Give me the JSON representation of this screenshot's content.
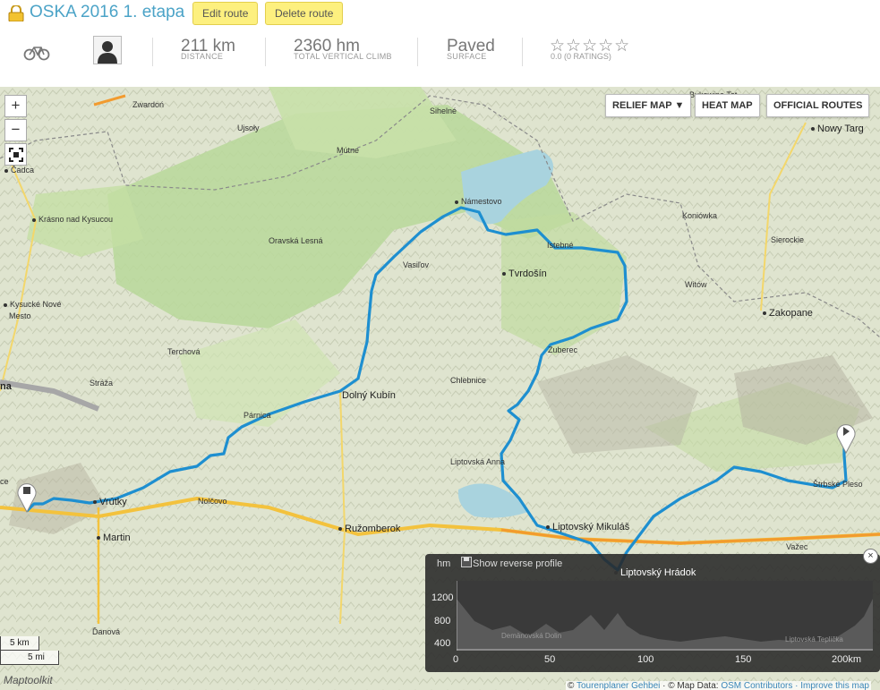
{
  "header": {
    "title": "OSKA 2016 1. etapa",
    "edit_label": "Edit route",
    "delete_label": "Delete route",
    "stats": [
      {
        "value": "211 km",
        "label": "DISTANCE"
      },
      {
        "value": "2360 hm",
        "label": "TOTAL VERTICAL CLIMB"
      },
      {
        "value": "Paved",
        "label": "SURFACE"
      }
    ],
    "stars": "☆☆☆☆☆",
    "ratings": "0.0 (0 RATINGS)",
    "icons": {
      "lock": "lock-icon",
      "bike": "bicycle-icon",
      "avatar": "user-avatar-icon"
    }
  },
  "map": {
    "zoom_in": "+",
    "zoom_out": "−",
    "buttons": {
      "relief": "RELIEF MAP ▼",
      "heat": "HEAT MAP",
      "official": "OFFICIAL ROUTES"
    },
    "places": {
      "zwardon": "Zwardoń",
      "ujsoly": "Ujsoły",
      "mutne": "Mútne",
      "sihelne": "Sihelné",
      "cadca": "Čadca",
      "krasno": "Krásno nad Kysucou",
      "oravska": "Oravská Lesná",
      "namestovo": "Námestovo",
      "kysucke1": "Kysucké Nové",
      "kysucke2": "Mesto",
      "vasilov": "Vasiľov",
      "tvrdosin": "Tvrdošín",
      "terchova": "Terchová",
      "zuberec": "Zuberec",
      "straza": "Stráža",
      "chlebnice": "Chlebnice",
      "dolny": "Dolný Kubín",
      "parnica": "Párnica",
      "zilina": "na",
      "liptovska_anna": "Liptovská Anna",
      "ce": "ce",
      "vrutky": "Vrútky",
      "nolcovo": "Nolčovo",
      "martin": "Martin",
      "ruzomberok": "Ružomberok",
      "mikulas": "Liptovský Mikuláš",
      "hradok": "Liptovský Hrádok",
      "danova": "Ďanová",
      "nowy_targ": "Nowy Targ",
      "koniowka": "Koniówka",
      "sierockie": "Sierockie",
      "witow": "Witów",
      "zakopane": "Zakopane",
      "strbske": "Štrbské Pleso",
      "vazec": "Važec",
      "bukowina": "Bukowina Tat.",
      "skrutna": "Istebné"
    },
    "scale_km": "5 km",
    "scale_mi": "5 mi",
    "brand": "Maptoolkit",
    "footer": {
      "copy": "© ",
      "tourenplaner": "Tourenplaner Gehbei",
      "mapdata": " · © Map Data: ",
      "osm": "OSM Contributors",
      "improve": " · Improve this map"
    }
  },
  "profile": {
    "unit": "hm",
    "reverse_label": "Show reverse profile",
    "y_ticks": [
      "1200",
      "800",
      "400"
    ],
    "x_ticks": [
      "0",
      "50",
      "100",
      "150",
      "200km"
    ],
    "inner_labels": {
      "demanovska": "Demänovská Dolin",
      "teplicka": "Liptovská Teplička"
    },
    "close": "×"
  },
  "colors": {
    "route": "#1e8fd0",
    "accent": "#4ba3c7",
    "button_yellow": "#fdf07f"
  }
}
